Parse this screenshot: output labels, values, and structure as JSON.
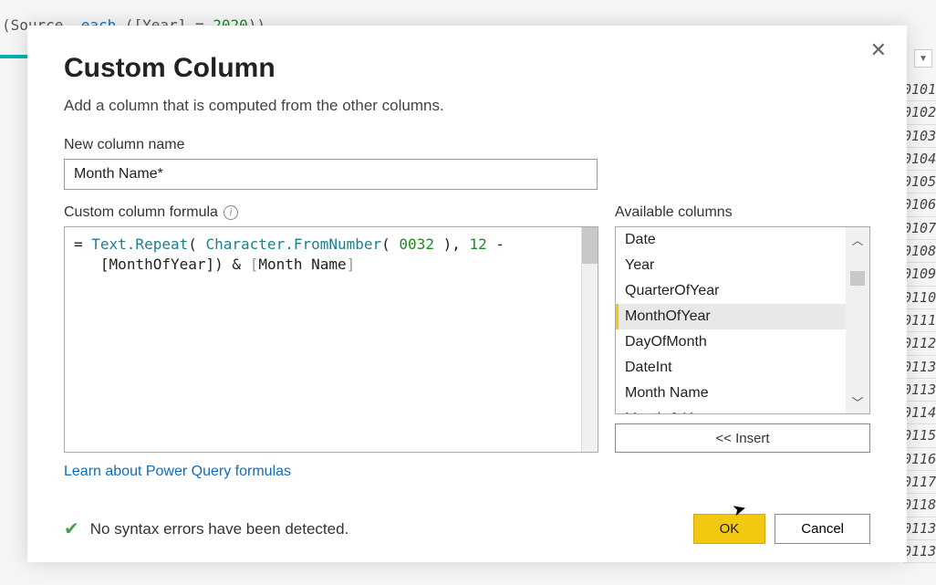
{
  "background": {
    "code_prefix": "(Source",
    "code_keyword": "each",
    "code_suffix": "([Year]",
    "code_eq": "=",
    "code_num": "2020",
    "code_close": "))",
    "data_rows": [
      "0101",
      "0102",
      "0103",
      "0104",
      "0105",
      "0106",
      "0107",
      "0108",
      "0109",
      "0110",
      "0111",
      "0112",
      "0113",
      "0113",
      "0114",
      "0115",
      "0116",
      "0117",
      "0118",
      "0113",
      "0113"
    ]
  },
  "dialog": {
    "title": "Custom Column",
    "subtitle": "Add a column that is computed from the other columns.",
    "name_label": "New column name",
    "name_value": "Month Name*",
    "formula_label": "Custom column formula",
    "formula": {
      "eq": "= ",
      "fn1": "Text.Repeat",
      "paren1": "( ",
      "fn2": "Character.FromNumber",
      "paren2": "( ",
      "num1": "0032",
      "paren3": " ), ",
      "num2": "12",
      "minus": " -",
      "line2_open": "   [",
      "col1": "MonthOfYear",
      "line2_mid": "]) & ",
      "br_open": "[",
      "col2": "Month Name",
      "br_close": "]"
    },
    "avail_label": "Available columns",
    "avail_items": [
      "Date",
      "Year",
      "QuarterOfYear",
      "MonthOfYear",
      "DayOfMonth",
      "DateInt",
      "Month Name",
      "Month & Year"
    ],
    "selected_index": 3,
    "insert_label": "<< Insert",
    "learn_link": "Learn about Power Query formulas",
    "status": "No syntax errors have been detected.",
    "ok_label": "OK",
    "cancel_label": "Cancel"
  }
}
